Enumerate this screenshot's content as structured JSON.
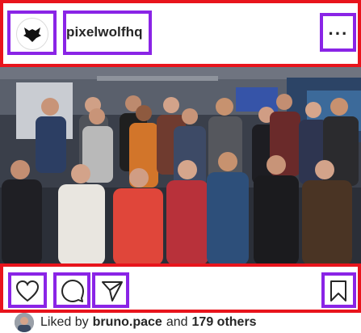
{
  "post": {
    "username": "pixelwolfhq",
    "more_label": "···",
    "photo_alt": "",
    "liked_by_prefix": "Liked by",
    "liked_by_user": "bruno.pace",
    "liked_by_and": "and",
    "liked_by_others": "179 others"
  },
  "icons": {
    "avatar": "wolf-logo-icon",
    "more": "more-options-icon",
    "like": "heart-icon",
    "comment": "comment-bubble-icon",
    "share": "paper-plane-icon",
    "save": "bookmark-icon"
  },
  "colors": {
    "annotation_red": "#e8141c",
    "annotation_purple": "#8a24e6",
    "text": "#262626"
  }
}
